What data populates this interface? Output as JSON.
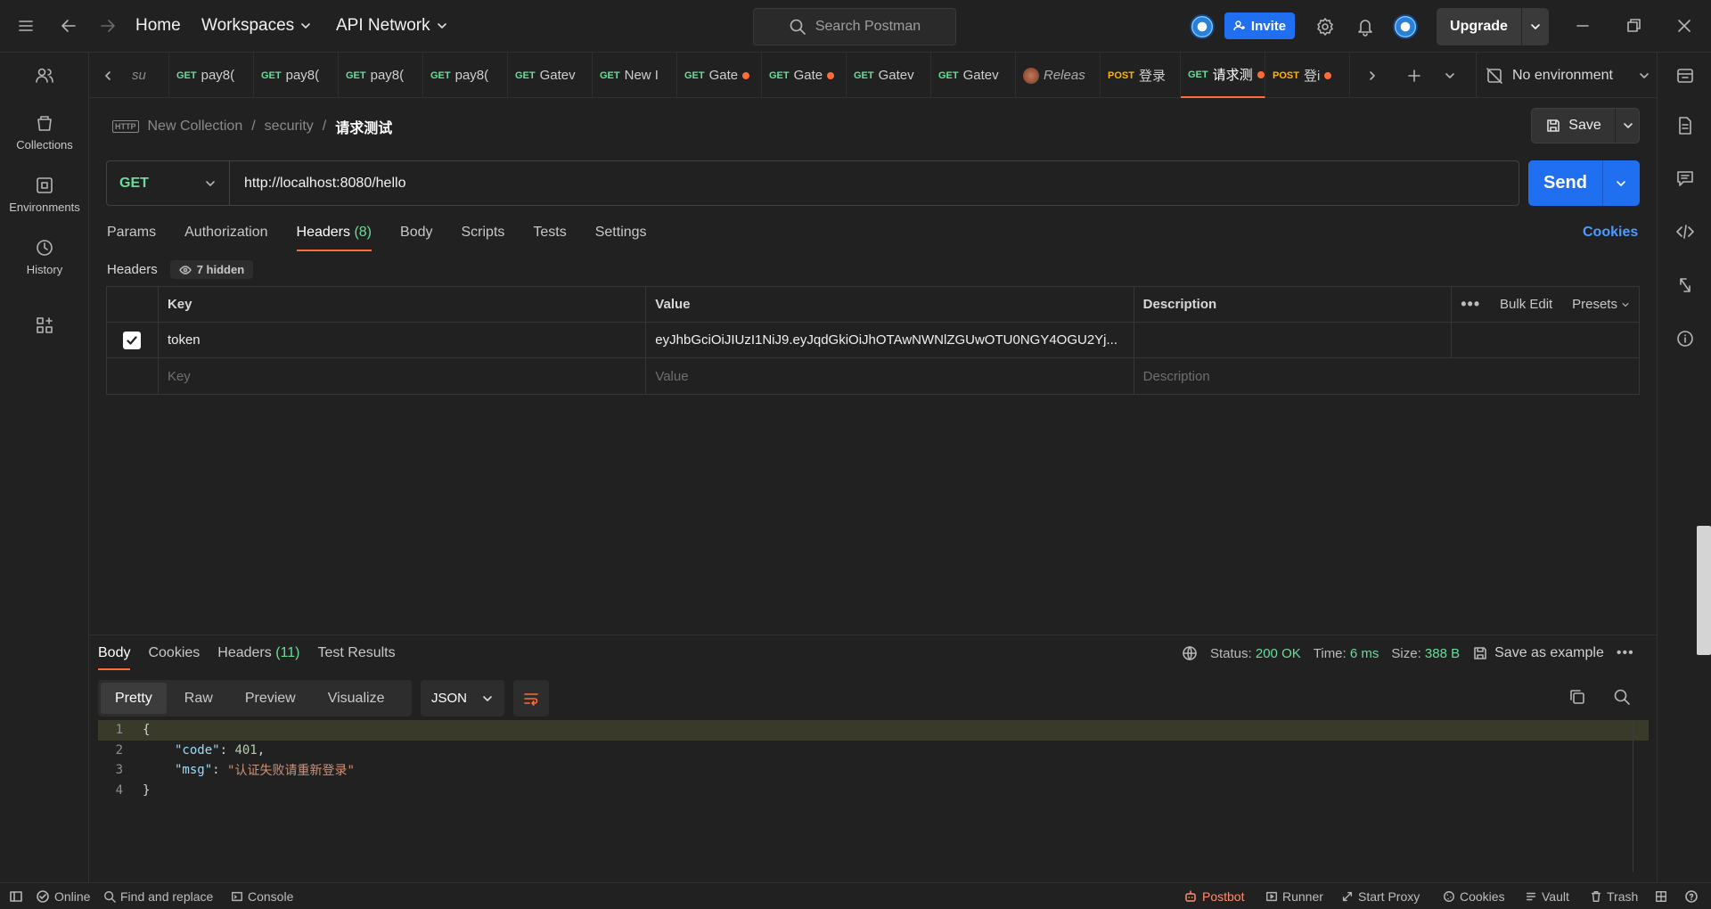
{
  "titlebar": {
    "home": "Home",
    "workspaces": "Workspaces",
    "api_network": "API Network",
    "search_placeholder": "Search Postman",
    "invite": "Invite",
    "upgrade": "Upgrade"
  },
  "sidebar": {
    "items": [
      {
        "label": "Collections",
        "icon": "collections-icon"
      },
      {
        "label": "Environments",
        "icon": "environments-icon"
      },
      {
        "label": "History",
        "icon": "history-icon"
      }
    ]
  },
  "tabs": [
    {
      "method": "",
      "label": "su",
      "dot": false
    },
    {
      "method": "GET",
      "label": "pay8(",
      "dot": false
    },
    {
      "method": "GET",
      "label": "pay8(",
      "dot": false
    },
    {
      "method": "GET",
      "label": "pay8(",
      "dot": false
    },
    {
      "method": "GET",
      "label": "pay8(",
      "dot": false
    },
    {
      "method": "GET",
      "label": "Gatev",
      "dot": false
    },
    {
      "method": "GET",
      "label": "New I",
      "dot": false
    },
    {
      "method": "GET",
      "label": "Gate",
      "dot": true
    },
    {
      "method": "GET",
      "label": "Gate",
      "dot": true
    },
    {
      "method": "GET",
      "label": "Gatev",
      "dot": false
    },
    {
      "method": "GET",
      "label": "Gatev",
      "dot": false
    },
    {
      "method": "",
      "label": "Releas",
      "dot": false
    },
    {
      "method": "POST",
      "label": "登录",
      "dot": false
    },
    {
      "method": "GET",
      "label": "请求测",
      "dot": true
    },
    {
      "method": "POST",
      "label": "登i",
      "dot": true
    }
  ],
  "environment": "No environment",
  "breadcrumb": {
    "collection": "New Collection",
    "folder": "security",
    "request": "请求测试",
    "sep": "/"
  },
  "save": "Save",
  "request": {
    "method": "GET",
    "url": "http://localhost:8080/hello",
    "send": "Send"
  },
  "req_tabs": {
    "params": "Params",
    "authorization": "Authorization",
    "headers": "Headers",
    "headers_count": "(8)",
    "body": "Body",
    "scripts": "Scripts",
    "tests": "Tests",
    "settings": "Settings",
    "cookies": "Cookies"
  },
  "headers_section": {
    "title": "Headers",
    "hidden": "7 hidden",
    "col_key": "Key",
    "col_value": "Value",
    "col_description": "Description",
    "bulk_edit": "Bulk Edit",
    "presets": "Presets",
    "rows": [
      {
        "key": "token",
        "value": "eyJhbGciOiJIUzI1NiJ9.eyJqdGkiOiJhOTAwNWNlZGUwOTU0NGY4OGU2Yj...",
        "description": ""
      }
    ],
    "placeholder_key": "Key",
    "placeholder_value": "Value",
    "placeholder_description": "Description"
  },
  "response": {
    "tabs": {
      "body": "Body",
      "cookies": "Cookies",
      "headers": "Headers",
      "headers_count": "(11)",
      "test_results": "Test Results"
    },
    "status_label": "Status:",
    "status": "200 OK",
    "time_label": "Time:",
    "time": "6 ms",
    "size_label": "Size:",
    "size": "388 B",
    "save_example": "Save as example",
    "formats": {
      "pretty": "Pretty",
      "raw": "Raw",
      "preview": "Preview",
      "visualize": "Visualize"
    },
    "lang": "JSON",
    "code": {
      "l1": "{",
      "k_code": "\"code\"",
      "v_code": "401",
      "k_msg": "\"msg\"",
      "v_msg": "\"认证失败请重新登录\"",
      "l4": "}"
    }
  },
  "statusbar": {
    "online": "Online",
    "find_replace": "Find and replace",
    "console": "Console",
    "postbot": "Postbot",
    "runner": "Runner",
    "start_proxy": "Start Proxy",
    "cookies": "Cookies",
    "vault": "Vault",
    "trash": "Trash"
  }
}
